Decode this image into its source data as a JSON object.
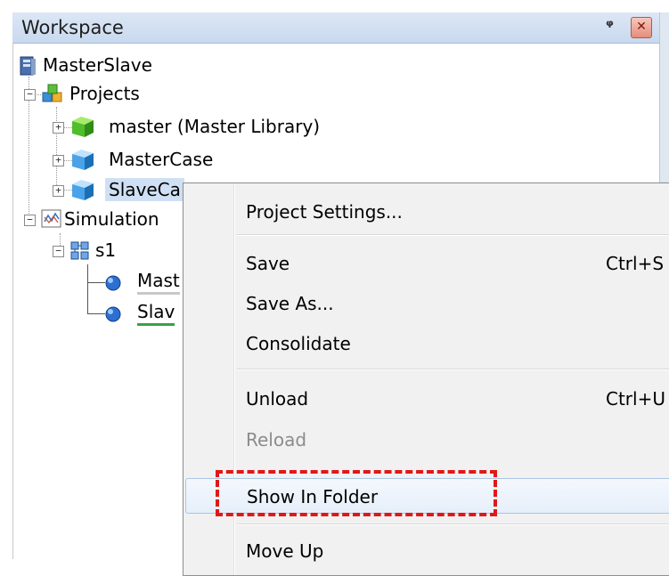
{
  "panel": {
    "title": "Workspace",
    "pin_glyph": "ᵠ",
    "close_glyph": "✕"
  },
  "tree": {
    "root": "MasterSlave",
    "projects": "Projects",
    "master": "master (Master Library)",
    "mastercase": "MasterCase",
    "slavecase": "SlaveCa",
    "simulation": "Simulation",
    "s1": "s1",
    "mast": "Mast",
    "slav": "Slav"
  },
  "menu": {
    "project_settings": "Project Settings...",
    "save": "Save",
    "save_shortcut": "Ctrl+S",
    "save_as": "Save As...",
    "consolidate": "Consolidate",
    "unload": "Unload",
    "unload_shortcut": "Ctrl+U",
    "reload": "Reload",
    "show_in_folder": "Show In Folder",
    "move_up": "Move Up"
  },
  "colors": {
    "highlight_dash": "#e01818",
    "selection": "#cfe0f5"
  },
  "icons": {
    "root": "server-icon",
    "projects": "projects-icon",
    "master": "green-cube-icon",
    "mastercase": "blue-cube-icon",
    "slavecase": "blue-cube-icon",
    "simulation": "chart-icon",
    "s1": "network-icon",
    "mast": "blue-sphere-icon",
    "slav": "blue-sphere-icon"
  }
}
